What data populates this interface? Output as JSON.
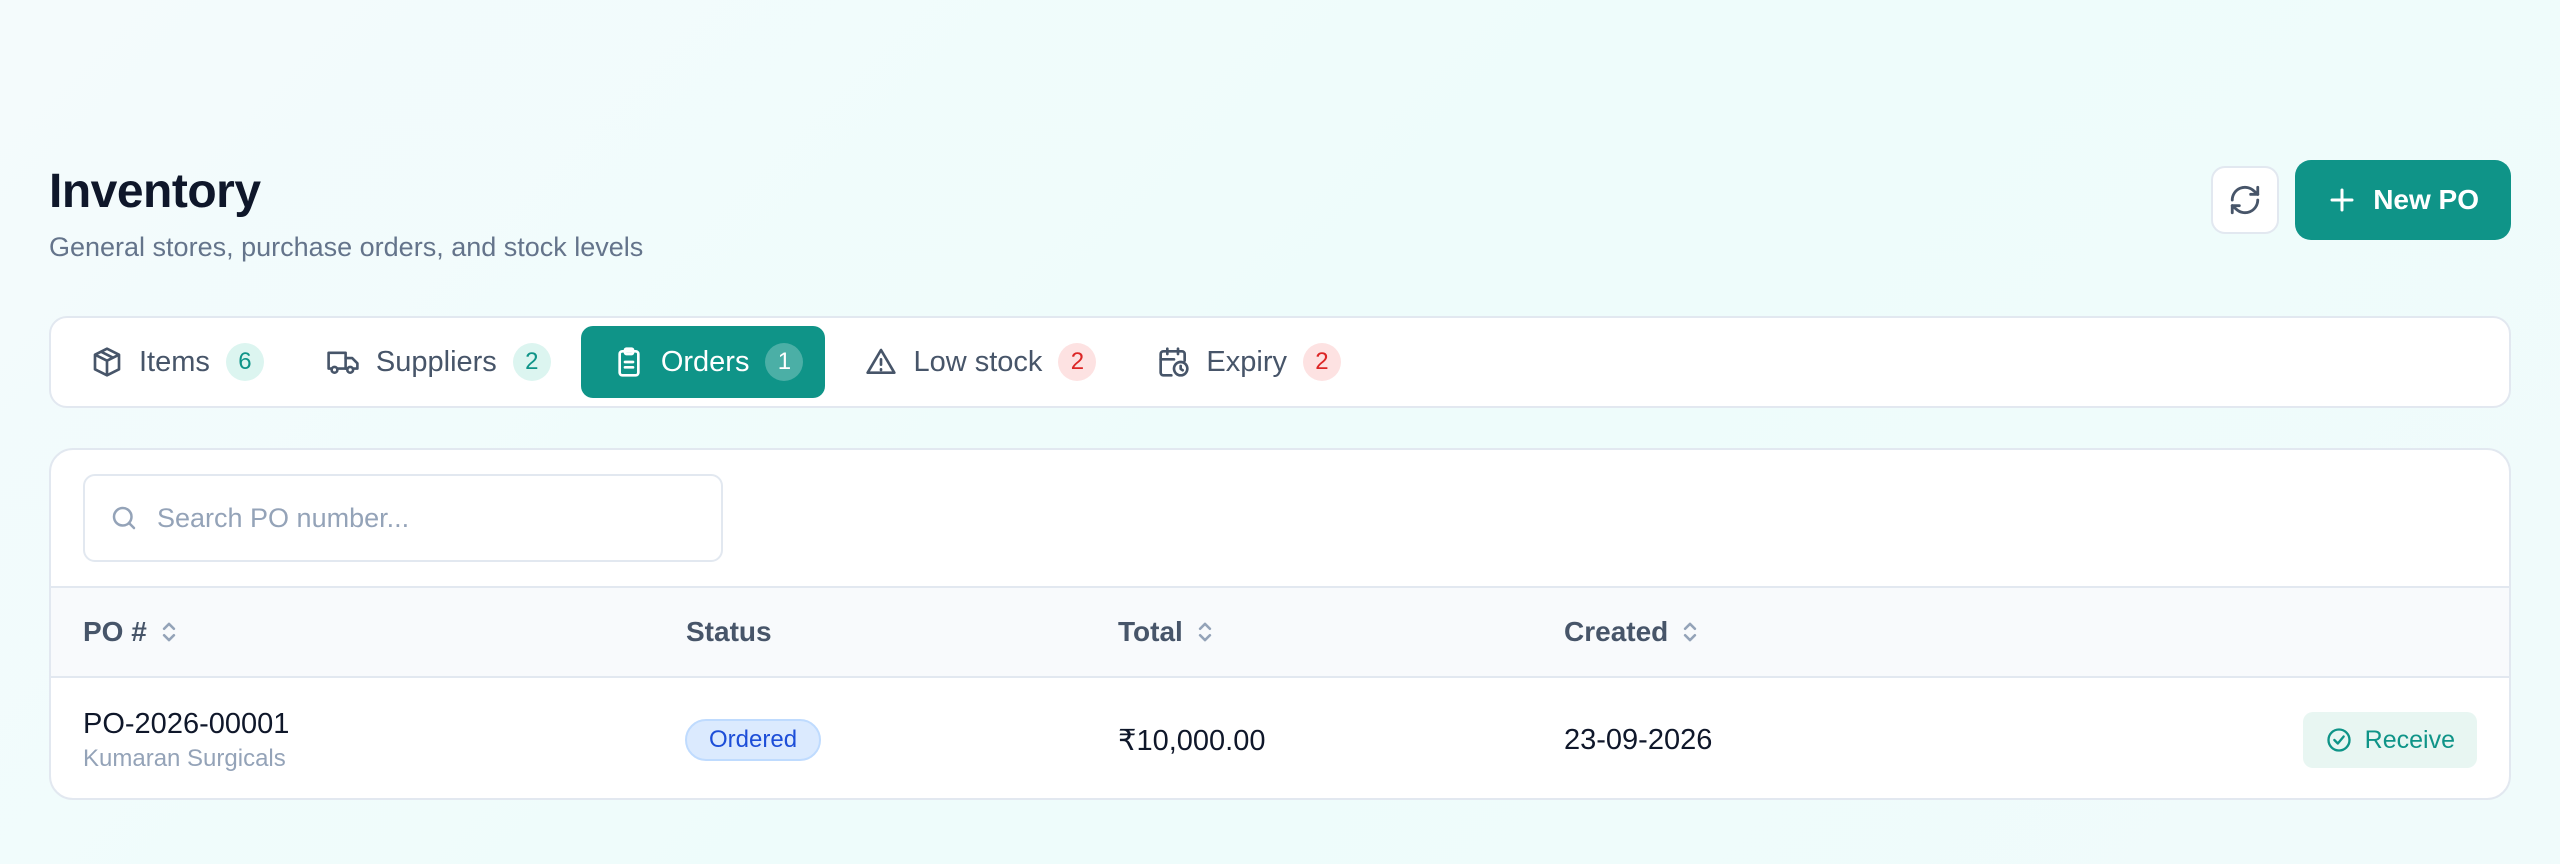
{
  "header": {
    "title": "Inventory",
    "subtitle": "General stores, purchase orders, and stock levels",
    "refresh_icon": "refresh-icon",
    "new_po_label": "New PO"
  },
  "tabs": [
    {
      "label": "Items",
      "count": "6",
      "icon": "box-icon",
      "badge_color": "teal",
      "active": false
    },
    {
      "label": "Suppliers",
      "count": "2",
      "icon": "truck-icon",
      "badge_color": "teal",
      "active": false
    },
    {
      "label": "Orders",
      "count": "1",
      "icon": "clipboard-icon",
      "badge_color": "teal",
      "active": true
    },
    {
      "label": "Low stock",
      "count": "2",
      "icon": "alert-triangle-icon",
      "badge_color": "red",
      "active": false
    },
    {
      "label": "Expiry",
      "count": "2",
      "icon": "calendar-clock-icon",
      "badge_color": "red",
      "active": false
    }
  ],
  "search": {
    "placeholder": "Search PO number...",
    "value": ""
  },
  "table": {
    "columns": {
      "po": "PO #",
      "status": "Status",
      "total": "Total",
      "created": "Created"
    },
    "rows": [
      {
        "po_number": "PO-2026-00001",
        "supplier": "Kumaran Surgicals",
        "status": "Ordered",
        "total": "₹10,000.00",
        "created": "23-09-2026",
        "action": "Receive"
      }
    ]
  },
  "colors": {
    "accent": "#0f9488",
    "status_ordered": "#1d4ed8",
    "badge_red": "#dc2626"
  }
}
